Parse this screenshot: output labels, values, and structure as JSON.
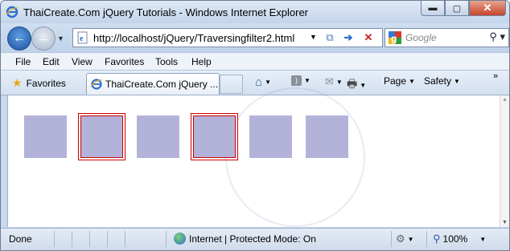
{
  "window": {
    "title": "ThaiCreate.Com jQuery Tutorials - Windows Internet Explorer",
    "caption": {
      "minimize": "▬",
      "maximize": "▢",
      "close": "✕"
    }
  },
  "address_bar": {
    "url": "http://localhost/jQuery/Traversingfilter2.html"
  },
  "search": {
    "placeholder": "Google"
  },
  "menu": [
    "File",
    "Edit",
    "View",
    "Favorites",
    "Tools",
    "Help"
  ],
  "favorites_bar": {
    "favorites_label": "Favorites",
    "tab_label": "ThaiCreate.Com jQuery ...",
    "page_label": "Page",
    "safety_label": "Safety"
  },
  "content": {
    "boxes": [
      {
        "highlighted": false
      },
      {
        "highlighted": true
      },
      {
        "highlighted": false
      },
      {
        "highlighted": true
      },
      {
        "highlighted": false
      },
      {
        "highlighted": false
      }
    ],
    "box_color": "#b3b3d9",
    "highlight_color": "#cc0000"
  },
  "status_bar": {
    "status": "Done",
    "zone": "Internet | Protected Mode: On",
    "zoom": "100%"
  },
  "icons": [
    "ie-icon",
    "back-icon",
    "forward-icon",
    "compatibility-icon",
    "refresh-icon",
    "stop-icon",
    "google-icon",
    "search-icon",
    "star-icon",
    "home-icon",
    "feeds-icon",
    "mail-icon",
    "print-icon",
    "globe-icon",
    "zoom-icon"
  ]
}
